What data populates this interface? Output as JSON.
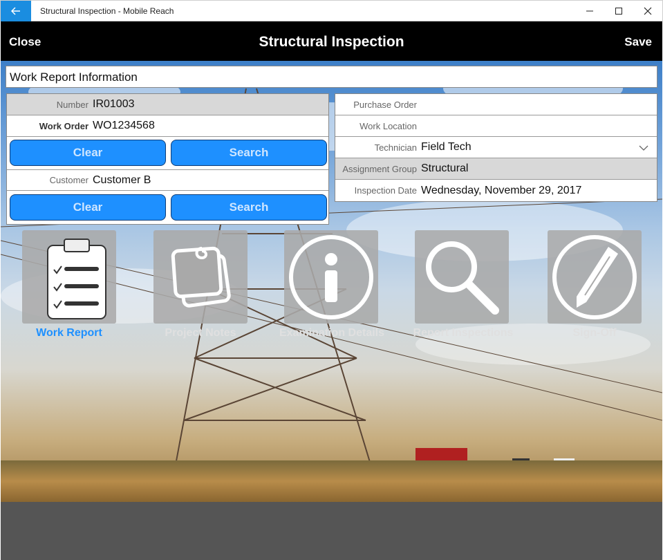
{
  "window": {
    "title": "Structural Inspection - Mobile Reach"
  },
  "appbar": {
    "close": "Close",
    "title": "Structural Inspection",
    "save": "Save"
  },
  "section": {
    "header": "Work Report Information"
  },
  "left_panel": {
    "number": {
      "label": "Number",
      "value": "IR01003"
    },
    "work_order": {
      "label": "Work Order",
      "value": "WO1234568"
    },
    "customer": {
      "label": "Customer",
      "value": "Customer B"
    },
    "clear_label": "Clear",
    "search_label": "Search"
  },
  "right_panel": {
    "purchase_order": {
      "label": "Purchase Order",
      "value": ""
    },
    "work_location": {
      "label": "Work Location",
      "value": ""
    },
    "technician": {
      "label": "Technician",
      "value": "Field Tech"
    },
    "assignment_group": {
      "label": "Assignment Group",
      "value": "Structural"
    },
    "inspection_date": {
      "label": "Inspection Date",
      "value": "Wednesday, November 29, 2017"
    }
  },
  "tiles": [
    {
      "label": "Work Report",
      "icon": "clipboard-checklist-icon",
      "active": true
    },
    {
      "label": "Project Notes",
      "icon": "notes-icon",
      "active": false
    },
    {
      "label": "Examination Details",
      "icon": "info-icon",
      "active": false
    },
    {
      "label": "Report Inspections",
      "icon": "magnifier-icon",
      "active": false
    },
    {
      "label": "Sign-Off",
      "icon": "pen-icon",
      "active": false
    }
  ],
  "colors": {
    "accent": "#1e90ff",
    "active_label": "#1e90ff",
    "inactive_label": "#dddddd",
    "appbar": "#000000"
  }
}
